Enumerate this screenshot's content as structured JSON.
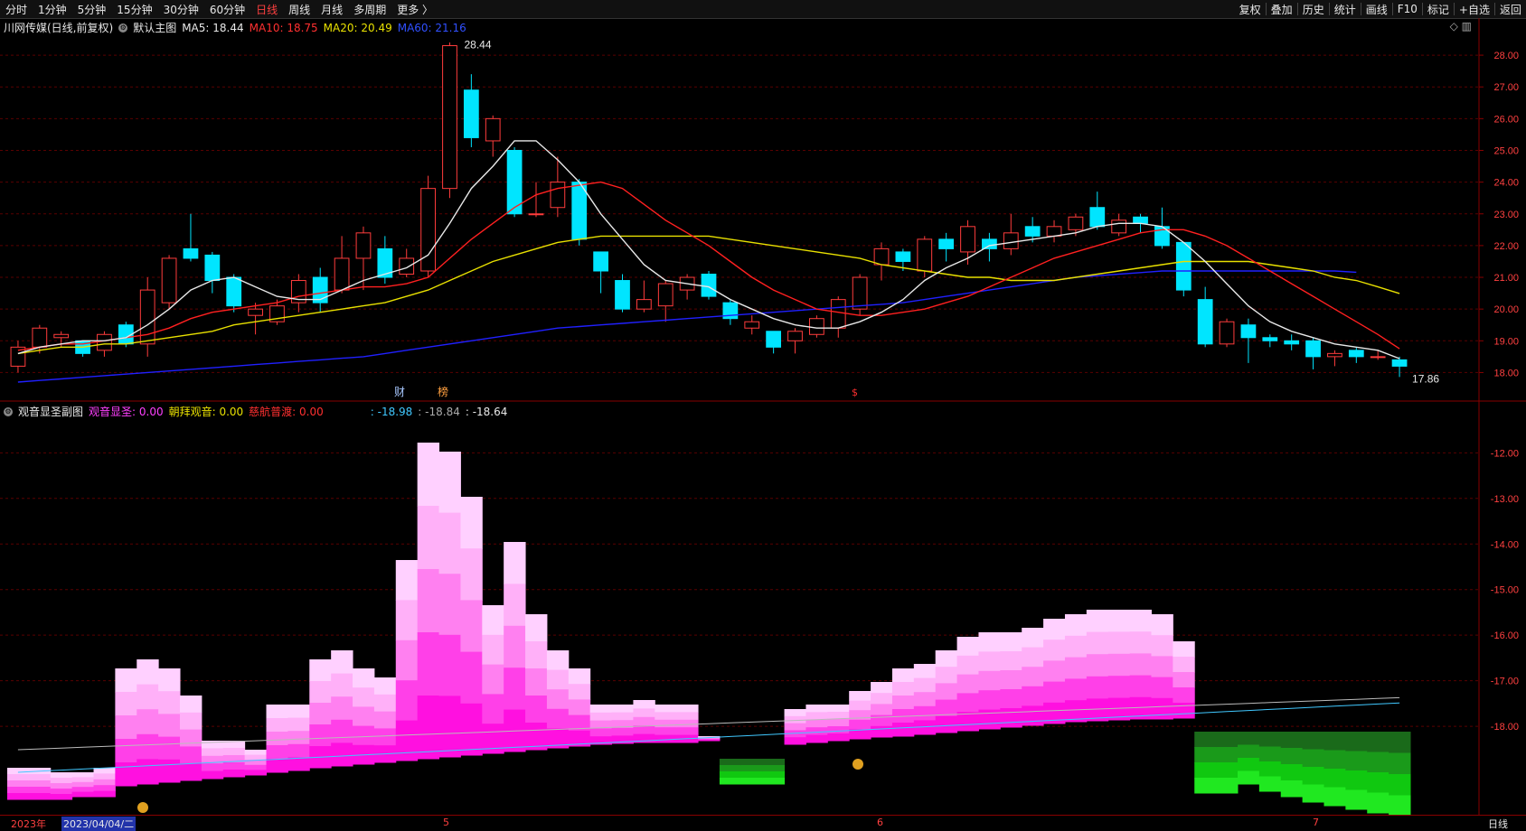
{
  "toolbar": {
    "periods": [
      "分时",
      "1分钟",
      "5分钟",
      "15分钟",
      "30分钟",
      "60分钟",
      "日线",
      "周线",
      "月线",
      "多周期",
      "更多 〉"
    ],
    "active_period": "日线",
    "right_buttons": [
      "复权",
      "叠加",
      "历史",
      "统计",
      "画线",
      "F10",
      "标记",
      "+自选",
      "返回"
    ]
  },
  "main_header": {
    "stock": "川网传媒(日线,前复权)",
    "chart_name": "默认主图",
    "ma5": "MA5: 18.44",
    "ma10": "MA10: 18.75",
    "ma20": "MA20: 20.49",
    "ma60": "MA60: 21.16",
    "icons": "◇ ▥"
  },
  "sub_header": {
    "name": "观音显圣副图",
    "v1": "观音显圣: 0.00",
    "v2": "朝拜观音: 0.00",
    "v3": "慈航普渡: 0.00",
    "v4": ": -18.98",
    "v5": ": -18.84",
    "v6": ": -18.64"
  },
  "colors": {
    "up": "#ff3c3c",
    "down": "#00e5ff",
    "ma5": "#e8e8e8",
    "ma10": "#ff2020",
    "ma20": "#e8e000",
    "ma60": "#2020ff",
    "grid": "#5a0000"
  },
  "price_axis": [
    "28.00",
    "27.00",
    "26.00",
    "25.00",
    "24.00",
    "23.00",
    "22.00",
    "21.00",
    "20.00",
    "19.00",
    "18.00"
  ],
  "sub_axis": [
    "-12.00",
    "-13.00",
    "-14.00",
    "-15.00",
    "-16.00",
    "-17.00",
    "-18.00"
  ],
  "annotations": {
    "high": "28.44",
    "low": "17.86",
    "marker_cai": "财",
    "marker_bang": "榜",
    "marker_s": "$"
  },
  "bottom": {
    "year": "2023年",
    "date": "2023/04/04/二",
    "m5": "5",
    "m6": "6",
    "m7": "7",
    "period": "日线"
  },
  "chart_data": {
    "type": "candlestick",
    "y_range": [
      17.5,
      28.6
    ],
    "candles": [
      [
        18.2,
        18.8,
        19.0,
        18.0
      ],
      [
        18.8,
        19.4,
        19.5,
        18.6
      ],
      [
        19.1,
        19.2,
        19.3,
        18.8
      ],
      [
        19.0,
        18.6,
        19.0,
        18.5
      ],
      [
        18.7,
        19.2,
        19.3,
        18.5
      ],
      [
        19.5,
        18.9,
        19.6,
        18.8
      ],
      [
        18.9,
        20.6,
        21.0,
        18.5
      ],
      [
        20.2,
        21.6,
        21.7,
        20.0
      ],
      [
        21.9,
        21.6,
        23.0,
        21.5
      ],
      [
        21.7,
        20.9,
        21.8,
        20.5
      ],
      [
        21.0,
        20.1,
        21.1,
        19.9
      ],
      [
        19.8,
        20.0,
        20.2,
        19.2
      ],
      [
        19.6,
        20.1,
        20.3,
        19.5
      ],
      [
        20.2,
        20.9,
        21.1,
        19.9
      ],
      [
        21.0,
        20.2,
        21.3,
        19.9
      ],
      [
        20.6,
        21.6,
        22.3,
        20.5
      ],
      [
        21.6,
        22.4,
        22.6,
        20.6
      ],
      [
        21.9,
        21.0,
        22.3,
        20.8
      ],
      [
        21.1,
        21.6,
        21.9,
        21.0
      ],
      [
        21.2,
        23.8,
        24.2,
        21.0
      ],
      [
        23.8,
        28.3,
        28.4,
        23.5
      ],
      [
        26.9,
        25.4,
        27.4,
        25.1
      ],
      [
        25.3,
        26.0,
        26.1,
        24.8
      ],
      [
        25.0,
        23.0,
        25.1,
        22.9
      ],
      [
        23.0,
        23.0,
        24.0,
        22.9
      ],
      [
        23.2,
        24.0,
        24.8,
        22.9
      ],
      [
        24.0,
        22.2,
        24.1,
        22.0
      ],
      [
        21.8,
        21.2,
        21.8,
        20.5
      ],
      [
        20.9,
        20.0,
        21.1,
        19.9
      ],
      [
        20.0,
        20.3,
        20.9,
        19.9
      ],
      [
        20.1,
        20.8,
        20.9,
        19.6
      ],
      [
        20.6,
        21.0,
        21.1,
        20.3
      ],
      [
        21.1,
        20.4,
        21.2,
        20.3
      ],
      [
        20.2,
        19.7,
        20.3,
        19.5
      ],
      [
        19.4,
        19.6,
        19.8,
        19.2
      ],
      [
        19.3,
        18.8,
        19.3,
        18.6
      ],
      [
        19.0,
        19.3,
        19.4,
        18.6
      ],
      [
        19.2,
        19.7,
        19.8,
        19.1
      ],
      [
        19.4,
        20.3,
        20.4,
        19.1
      ],
      [
        20.0,
        21.0,
        21.1,
        19.8
      ],
      [
        21.4,
        21.9,
        22.1,
        20.9
      ],
      [
        21.8,
        21.5,
        21.9,
        21.2
      ],
      [
        21.2,
        22.2,
        22.3,
        21.0
      ],
      [
        22.2,
        21.9,
        22.4,
        21.5
      ],
      [
        21.8,
        22.6,
        22.8,
        21.4
      ],
      [
        22.2,
        21.9,
        22.4,
        21.5
      ],
      [
        21.9,
        22.4,
        23.0,
        21.7
      ],
      [
        22.6,
        22.3,
        22.9,
        22.1
      ],
      [
        22.3,
        22.6,
        22.8,
        22.1
      ],
      [
        22.5,
        22.9,
        23.0,
        22.3
      ],
      [
        23.2,
        22.6,
        23.7,
        22.5
      ],
      [
        22.4,
        22.8,
        23.0,
        22.3
      ],
      [
        22.9,
        22.7,
        23.0,
        22.4
      ],
      [
        22.6,
        22.0,
        23.2,
        21.9
      ],
      [
        22.1,
        20.6,
        22.1,
        20.4
      ],
      [
        20.3,
        18.9,
        20.7,
        18.8
      ],
      [
        18.9,
        19.6,
        19.7,
        18.8
      ],
      [
        19.5,
        19.1,
        19.7,
        18.3
      ],
      [
        19.1,
        19.0,
        19.2,
        18.8
      ],
      [
        19.0,
        18.9,
        19.2,
        18.7
      ],
      [
        19.0,
        18.5,
        19.1,
        18.1
      ],
      [
        18.5,
        18.6,
        18.7,
        18.2
      ],
      [
        18.7,
        18.5,
        18.8,
        18.3
      ],
      [
        18.5,
        18.5,
        18.7,
        18.4
      ],
      [
        18.4,
        18.2,
        18.5,
        17.86
      ]
    ],
    "ma5": [
      18.6,
      18.8,
      18.9,
      19.0,
      19.0,
      19.1,
      19.5,
      20.0,
      20.6,
      20.9,
      21.0,
      20.7,
      20.4,
      20.3,
      20.3,
      20.6,
      20.9,
      21.1,
      21.3,
      21.7,
      22.7,
      23.8,
      24.5,
      25.3,
      25.3,
      24.7,
      24.0,
      23.0,
      22.2,
      21.4,
      20.9,
      20.8,
      20.7,
      20.3,
      20.0,
      19.7,
      19.5,
      19.4,
      19.4,
      19.6,
      19.9,
      20.3,
      20.9,
      21.3,
      21.6,
      22.0,
      22.1,
      22.2,
      22.3,
      22.4,
      22.6,
      22.7,
      22.7,
      22.6,
      22.1,
      21.5,
      20.8,
      20.1,
      19.6,
      19.3,
      19.1,
      18.9,
      18.8,
      18.7,
      18.44
    ],
    "ma10": [
      18.7,
      18.8,
      18.9,
      18.9,
      19.0,
      19.1,
      19.2,
      19.4,
      19.7,
      19.9,
      20.0,
      20.1,
      20.2,
      20.4,
      20.5,
      20.6,
      20.7,
      20.7,
      20.8,
      21.0,
      21.6,
      22.2,
      22.7,
      23.2,
      23.6,
      23.8,
      23.9,
      24.0,
      23.8,
      23.3,
      22.8,
      22.4,
      22.0,
      21.5,
      21.0,
      20.6,
      20.3,
      20.0,
      19.9,
      19.8,
      19.8,
      19.9,
      20.0,
      20.2,
      20.4,
      20.7,
      21.0,
      21.3,
      21.6,
      21.8,
      22.0,
      22.2,
      22.4,
      22.5,
      22.5,
      22.3,
      22.0,
      21.6,
      21.2,
      20.8,
      20.4,
      20.0,
      19.6,
      19.2,
      18.75
    ],
    "ma20": [
      18.6,
      18.7,
      18.8,
      18.8,
      18.9,
      18.9,
      19.0,
      19.1,
      19.2,
      19.3,
      19.5,
      19.6,
      19.7,
      19.8,
      19.9,
      20.0,
      20.1,
      20.2,
      20.4,
      20.6,
      20.9,
      21.2,
      21.5,
      21.7,
      21.9,
      22.1,
      22.2,
      22.3,
      22.3,
      22.3,
      22.3,
      22.3,
      22.3,
      22.2,
      22.1,
      22.0,
      21.9,
      21.8,
      21.7,
      21.6,
      21.4,
      21.3,
      21.2,
      21.1,
      21.0,
      21.0,
      20.9,
      20.9,
      20.9,
      21.0,
      21.1,
      21.2,
      21.3,
      21.4,
      21.5,
      21.5,
      21.5,
      21.5,
      21.4,
      21.3,
      21.2,
      21.0,
      20.9,
      20.7,
      20.49
    ],
    "ma60": [
      17.7,
      17.75,
      17.8,
      17.85,
      17.9,
      17.95,
      18.0,
      18.05,
      18.1,
      18.15,
      18.2,
      18.25,
      18.3,
      18.35,
      18.4,
      18.45,
      18.5,
      18.6,
      18.7,
      18.8,
      18.9,
      19.0,
      19.1,
      19.2,
      19.3,
      19.4,
      19.45,
      19.5,
      19.55,
      19.6,
      19.65,
      19.7,
      19.75,
      19.8,
      19.85,
      19.9,
      19.95,
      20.0,
      20.05,
      20.1,
      20.15,
      20.2,
      20.3,
      20.4,
      20.5,
      20.6,
      20.7,
      20.8,
      20.9,
      21.0,
      21.05,
      21.1,
      21.15,
      21.2,
      21.2,
      21.2,
      21.2,
      21.2,
      21.2,
      21.2,
      21.2,
      21.2,
      21.16
    ]
  }
}
